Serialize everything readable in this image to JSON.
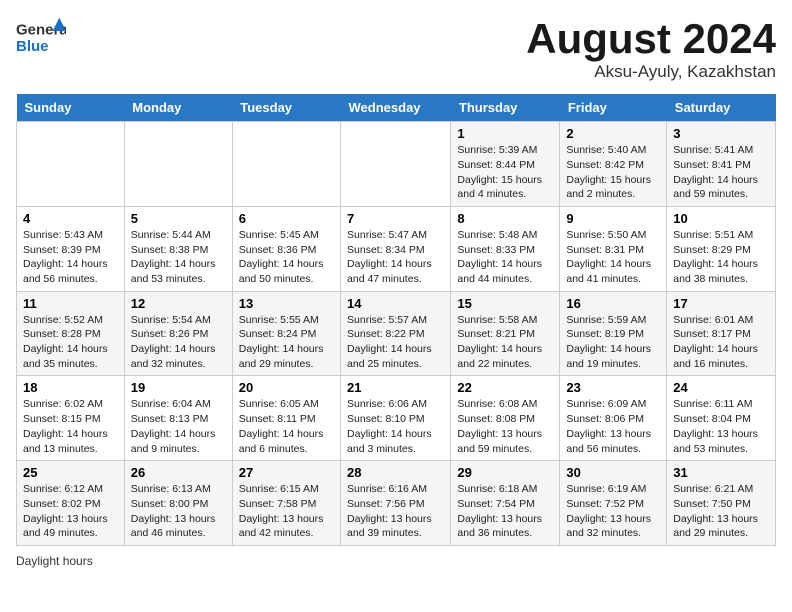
{
  "header": {
    "logo_general": "General",
    "logo_blue": "Blue",
    "month_title": "August 2024",
    "location": "Aksu-Ayuly, Kazakhstan"
  },
  "calendar": {
    "days_of_week": [
      "Sunday",
      "Monday",
      "Tuesday",
      "Wednesday",
      "Thursday",
      "Friday",
      "Saturday"
    ],
    "weeks": [
      [
        {
          "day": "",
          "info": ""
        },
        {
          "day": "",
          "info": ""
        },
        {
          "day": "",
          "info": ""
        },
        {
          "day": "",
          "info": ""
        },
        {
          "day": "1",
          "info": "Sunrise: 5:39 AM\nSunset: 8:44 PM\nDaylight: 15 hours and 4 minutes."
        },
        {
          "day": "2",
          "info": "Sunrise: 5:40 AM\nSunset: 8:42 PM\nDaylight: 15 hours and 2 minutes."
        },
        {
          "day": "3",
          "info": "Sunrise: 5:41 AM\nSunset: 8:41 PM\nDaylight: 14 hours and 59 minutes."
        }
      ],
      [
        {
          "day": "4",
          "info": "Sunrise: 5:43 AM\nSunset: 8:39 PM\nDaylight: 14 hours and 56 minutes."
        },
        {
          "day": "5",
          "info": "Sunrise: 5:44 AM\nSunset: 8:38 PM\nDaylight: 14 hours and 53 minutes."
        },
        {
          "day": "6",
          "info": "Sunrise: 5:45 AM\nSunset: 8:36 PM\nDaylight: 14 hours and 50 minutes."
        },
        {
          "day": "7",
          "info": "Sunrise: 5:47 AM\nSunset: 8:34 PM\nDaylight: 14 hours and 47 minutes."
        },
        {
          "day": "8",
          "info": "Sunrise: 5:48 AM\nSunset: 8:33 PM\nDaylight: 14 hours and 44 minutes."
        },
        {
          "day": "9",
          "info": "Sunrise: 5:50 AM\nSunset: 8:31 PM\nDaylight: 14 hours and 41 minutes."
        },
        {
          "day": "10",
          "info": "Sunrise: 5:51 AM\nSunset: 8:29 PM\nDaylight: 14 hours and 38 minutes."
        }
      ],
      [
        {
          "day": "11",
          "info": "Sunrise: 5:52 AM\nSunset: 8:28 PM\nDaylight: 14 hours and 35 minutes."
        },
        {
          "day": "12",
          "info": "Sunrise: 5:54 AM\nSunset: 8:26 PM\nDaylight: 14 hours and 32 minutes."
        },
        {
          "day": "13",
          "info": "Sunrise: 5:55 AM\nSunset: 8:24 PM\nDaylight: 14 hours and 29 minutes."
        },
        {
          "day": "14",
          "info": "Sunrise: 5:57 AM\nSunset: 8:22 PM\nDaylight: 14 hours and 25 minutes."
        },
        {
          "day": "15",
          "info": "Sunrise: 5:58 AM\nSunset: 8:21 PM\nDaylight: 14 hours and 22 minutes."
        },
        {
          "day": "16",
          "info": "Sunrise: 5:59 AM\nSunset: 8:19 PM\nDaylight: 14 hours and 19 minutes."
        },
        {
          "day": "17",
          "info": "Sunrise: 6:01 AM\nSunset: 8:17 PM\nDaylight: 14 hours and 16 minutes."
        }
      ],
      [
        {
          "day": "18",
          "info": "Sunrise: 6:02 AM\nSunset: 8:15 PM\nDaylight: 14 hours and 13 minutes."
        },
        {
          "day": "19",
          "info": "Sunrise: 6:04 AM\nSunset: 8:13 PM\nDaylight: 14 hours and 9 minutes."
        },
        {
          "day": "20",
          "info": "Sunrise: 6:05 AM\nSunset: 8:11 PM\nDaylight: 14 hours and 6 minutes."
        },
        {
          "day": "21",
          "info": "Sunrise: 6:06 AM\nSunset: 8:10 PM\nDaylight: 14 hours and 3 minutes."
        },
        {
          "day": "22",
          "info": "Sunrise: 6:08 AM\nSunset: 8:08 PM\nDaylight: 13 hours and 59 minutes."
        },
        {
          "day": "23",
          "info": "Sunrise: 6:09 AM\nSunset: 8:06 PM\nDaylight: 13 hours and 56 minutes."
        },
        {
          "day": "24",
          "info": "Sunrise: 6:11 AM\nSunset: 8:04 PM\nDaylight: 13 hours and 53 minutes."
        }
      ],
      [
        {
          "day": "25",
          "info": "Sunrise: 6:12 AM\nSunset: 8:02 PM\nDaylight: 13 hours and 49 minutes."
        },
        {
          "day": "26",
          "info": "Sunrise: 6:13 AM\nSunset: 8:00 PM\nDaylight: 13 hours and 46 minutes."
        },
        {
          "day": "27",
          "info": "Sunrise: 6:15 AM\nSunset: 7:58 PM\nDaylight: 13 hours and 42 minutes."
        },
        {
          "day": "28",
          "info": "Sunrise: 6:16 AM\nSunset: 7:56 PM\nDaylight: 13 hours and 39 minutes."
        },
        {
          "day": "29",
          "info": "Sunrise: 6:18 AM\nSunset: 7:54 PM\nDaylight: 13 hours and 36 minutes."
        },
        {
          "day": "30",
          "info": "Sunrise: 6:19 AM\nSunset: 7:52 PM\nDaylight: 13 hours and 32 minutes."
        },
        {
          "day": "31",
          "info": "Sunrise: 6:21 AM\nSunset: 7:50 PM\nDaylight: 13 hours and 29 minutes."
        }
      ]
    ]
  },
  "footer": {
    "daylight_label": "Daylight hours"
  }
}
